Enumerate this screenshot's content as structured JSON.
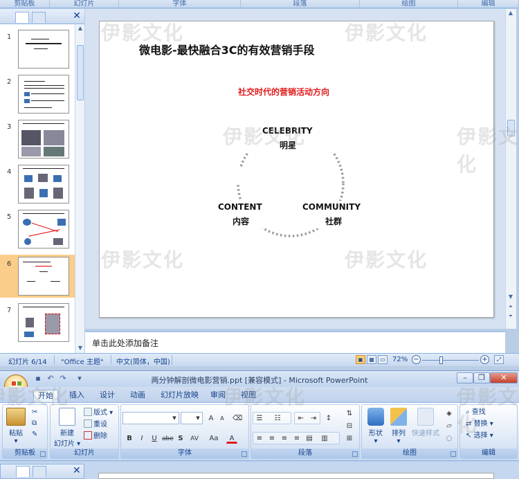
{
  "top_ribbon_groups": [
    "剪贴板",
    "幻灯片",
    "字体",
    "段落",
    "绘图",
    "编辑"
  ],
  "slides": [
    {
      "num": "1",
      "selected": false
    },
    {
      "num": "2",
      "selected": false
    },
    {
      "num": "3",
      "selected": false
    },
    {
      "num": "4",
      "selected": false
    },
    {
      "num": "5",
      "selected": false
    },
    {
      "num": "6",
      "selected": true
    },
    {
      "num": "7",
      "selected": false
    }
  ],
  "slide": {
    "title": "微电影-最快融合3C的有效营销手段",
    "subtitle": "社交时代的营销活动方向",
    "celebrity_en": "CELEBRITY",
    "celebrity_cn": "明星",
    "content_en": "CONTENT",
    "content_cn": "内容",
    "community_en": "COMMUNITY",
    "community_cn": "社群"
  },
  "notes_placeholder": "单击此处添加备注",
  "status": {
    "slide_counter": "幻灯片 6/14",
    "theme": "\"Office 主题\"",
    "language": "中文(简体，中国)",
    "zoom": "72%"
  },
  "window_title": "两分钟解剖微电影营销.ppt [兼容模式] - Microsoft PowerPoint",
  "ribbon_tabs": [
    "开始",
    "插入",
    "设计",
    "动画",
    "幻灯片放映",
    "审阅",
    "视图"
  ],
  "ribbon_active_tab": "开始",
  "ribbon": {
    "clipboard": {
      "paste": "粘贴",
      "group": "剪贴板"
    },
    "slides": {
      "new_slide_1": "新建",
      "new_slide_2": "幻灯片",
      "layout": "版式",
      "reset": "重设",
      "delete": "删除",
      "group": "幻灯片"
    },
    "font": {
      "group": "字体",
      "bold": "B",
      "italic": "I",
      "underline": "U",
      "strike": "abe",
      "shadow": "S",
      "spacing": "AV",
      "case": "Aa",
      "color": "A",
      "grow": "A",
      "shrink": "A"
    },
    "paragraph": {
      "group": "段落"
    },
    "drawing": {
      "shapes": "形状",
      "arrange": "排列",
      "quick_styles": "快速样式",
      "group": "绘图"
    },
    "editing": {
      "find": "查找",
      "replace": "替换",
      "select": "选择",
      "group": "编辑"
    }
  },
  "watermark": "伊影文化"
}
